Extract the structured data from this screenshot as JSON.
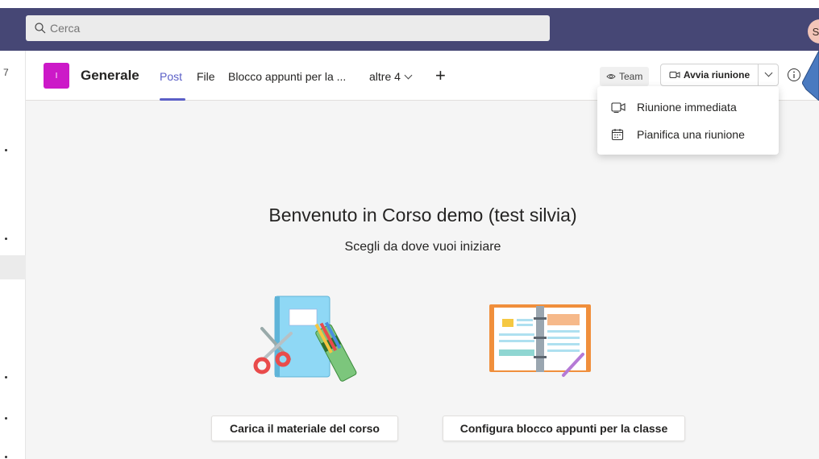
{
  "search": {
    "placeholder": "Cerca",
    "icon": "search-icon"
  },
  "user": {
    "initial": "S",
    "avatar_color": "#f3c5b8"
  },
  "left_rail": {
    "marks": [
      "7"
    ]
  },
  "header": {
    "team_tile_initial": "I",
    "team_tile_color": "#cc19c8",
    "channel_name": "Generale",
    "tabs": [
      {
        "label": "Post",
        "active": true
      },
      {
        "label": "File",
        "active": false
      },
      {
        "label": "Blocco appunti per la ...",
        "active": false
      },
      {
        "label": "altre 4",
        "active": false
      }
    ],
    "add_tab_label": "+",
    "team_button_label": "Team",
    "meeting_button_label": "Avvia riunione",
    "accent_color": "#5b5fc7"
  },
  "meeting_menu": {
    "items": [
      {
        "label": "Riunione immediata",
        "icon": "video-camera-icon"
      },
      {
        "label": "Pianifica una riunione",
        "icon": "calendar-icon"
      }
    ]
  },
  "main": {
    "welcome_title": "Benvenuto in Corso demo (test silvia)",
    "subtitle": "Scegli da dove vuoi iniziare",
    "upload_button_label": "Carica il materiale del corso",
    "notebook_button_label": "Configura blocco appunti per la classe"
  }
}
